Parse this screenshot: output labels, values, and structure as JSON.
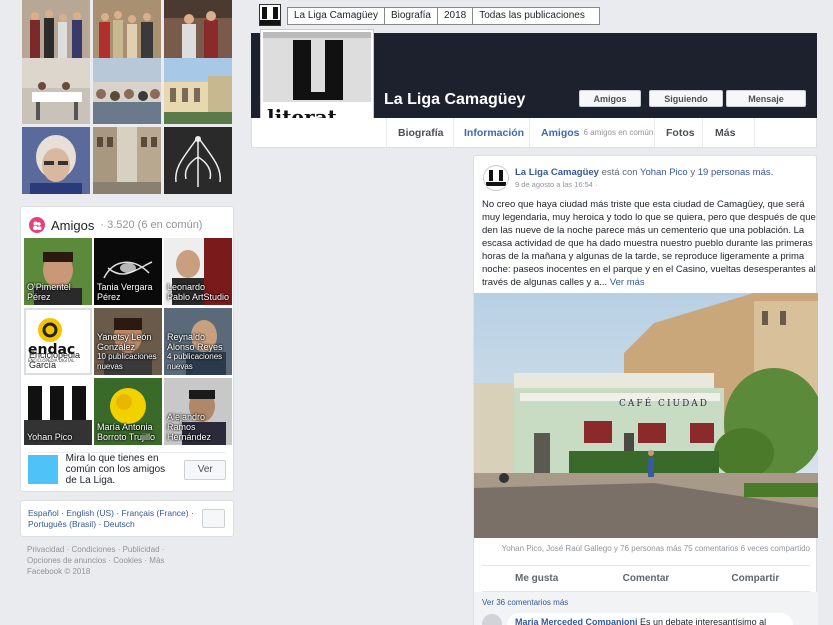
{
  "breadcrumb": {
    "items": [
      "La Liga Camagüey",
      "Biografía",
      "2018",
      "Todas las publicaciones"
    ]
  },
  "page": {
    "name": "La Liga Camagüey",
    "logo_text": "literat",
    "buttons": {
      "likes": "Amigos",
      "following": "Siguiendo",
      "message": "Mensaje"
    }
  },
  "nav": {
    "tabs": [
      {
        "label": "Biografía"
      },
      {
        "label": "Información"
      },
      {
        "label": "Amigos",
        "extra": "6 amigos en común"
      },
      {
        "label": "Fotos"
      },
      {
        "label": "Más"
      }
    ]
  },
  "friends": {
    "title": "Amigos",
    "count": "· 3.520 (6 en común)",
    "items": [
      {
        "name": "O'Pimentel Pérez",
        "sub": ""
      },
      {
        "name": "Tania Vergara Pérez",
        "sub": ""
      },
      {
        "name": "Leonardo Pablo ArtStudio",
        "sub": ""
      },
      {
        "name": "Enciclopedia García",
        "sub": ""
      },
      {
        "name": "Yanetsy León González",
        "sub": "10 publicaciones nuevas"
      },
      {
        "name": "Reynaldo Alonso Reyes",
        "sub": "4 publicaciones nuevas"
      },
      {
        "name": "Yohan Pico",
        "sub": ""
      },
      {
        "name": "María Antonia Borroto Trujillo",
        "sub": ""
      },
      {
        "name": "Alejandro Ramos Hernández",
        "sub": ""
      }
    ],
    "ecured_logo": "endac",
    "ecured_sub": "ENCICLOPEDIA DIGITAL",
    "mutual_text": "Mira lo que tienes en común con los amigos de La Liga.",
    "mutual_button": "Ver"
  },
  "languages": {
    "line1": "Español · English (US) · Français (France) ·",
    "line2": "Português (Brasil) · Deutsch"
  },
  "footer": {
    "line1": "Privacidad · Condiciones · Publicidad ·",
    "line2": "Opciones de anuncios · Cookies · Más",
    "line3": "Facebook © 2018"
  },
  "post": {
    "author": "La Liga Camagüey",
    "with_text": "está con",
    "tagged": "Yohan Pico",
    "and_text": "y",
    "others": "19 personas más.",
    "time": "9 de agosto a las 16:54 ·",
    "body": "No creo que haya ciudad más triste que esta ciudad de Camagüey, que será muy legendaria, muy heroica y todo lo que se quiera, pero que después de que den las nueve de la noche parece más un cementerio que una población. La escasa actividad de que ha dado muestra nuestro pueblo durante las primeras horas de la mañana y algunas de la tarde, se reproduce ligeramente a prima noche: paseos inocentes en el parque y en el Casino, vueltas desesperantes al través de algunas calles y a...",
    "see_more": "Ver más",
    "sign": "CAFÉ CIUDAD",
    "stats": "Yohan Pico, José Raúl Gallego y 76 personas más   75 comentarios   6 veces compartido",
    "actions": {
      "like": "Me gusta",
      "comment": "Comentar",
      "share": "Compartir"
    },
    "more_comments": "Ver 36 comentarios más",
    "comment_author": "Maria Merceded Companioni",
    "comment_text": "Es un debate interesantísimo al"
  }
}
